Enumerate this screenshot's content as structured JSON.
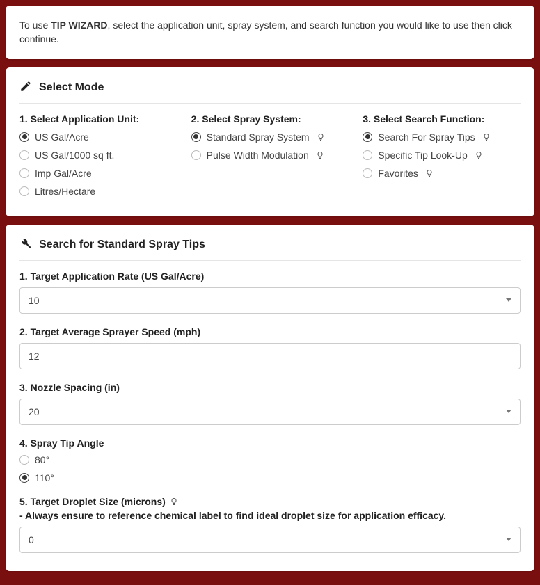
{
  "intro": {
    "pre": "To use ",
    "app_name": "TIP WIZARD",
    "post": ", select the application unit, spray system, and search function you would like to use then click continue."
  },
  "mode": {
    "title": "Select Mode",
    "col1": {
      "heading": "1. Select Application Unit:",
      "options": [
        {
          "label": "US Gal/Acre",
          "checked": true
        },
        {
          "label": "US Gal/1000 sq ft.",
          "checked": false
        },
        {
          "label": "Imp Gal/Acre",
          "checked": false
        },
        {
          "label": "Litres/Hectare",
          "checked": false
        }
      ]
    },
    "col2": {
      "heading": "2. Select Spray System:",
      "options": [
        {
          "label": "Standard Spray System",
          "checked": true,
          "hint": true
        },
        {
          "label": "Pulse Width Modulation",
          "checked": false,
          "hint": true
        }
      ]
    },
    "col3": {
      "heading": "3. Select Search Function:",
      "options": [
        {
          "label": "Search For Spray Tips",
          "checked": true,
          "hint": true
        },
        {
          "label": "Specific Tip Look-Up",
          "checked": false,
          "hint": true
        },
        {
          "label": "Favorites",
          "checked": false,
          "hint": true
        }
      ]
    }
  },
  "search": {
    "title": "Search for Standard Spray Tips",
    "f1": {
      "label": "1. Target Application Rate (US Gal/Acre)",
      "value": "10"
    },
    "f2": {
      "label": "2. Target Average Sprayer Speed (mph)",
      "value": "12"
    },
    "f3": {
      "label": "3. Nozzle Spacing (in)",
      "value": "20"
    },
    "f4": {
      "label": "4. Spray Tip Angle",
      "opt1": "80°",
      "opt2": "110°",
      "selected": "110"
    },
    "f5": {
      "label_main": "5. Target Droplet Size (microns)",
      "label_note": "  - Always ensure to reference chemical label to find ideal droplet size for application efficacy.",
      "value": "0"
    }
  }
}
